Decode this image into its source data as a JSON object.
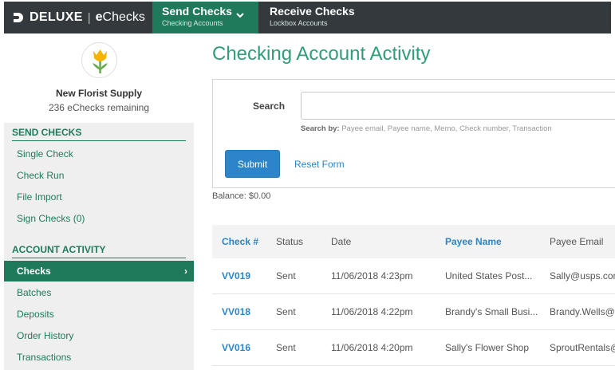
{
  "brand": {
    "name": "DELUXE",
    "separator": "|",
    "product_prefix": "e",
    "product_rest": "Checks"
  },
  "nav": {
    "send": {
      "title": "Send Checks",
      "subtitle": "Checking Accounts"
    },
    "receive": {
      "title": "Receive Checks",
      "subtitle": "Lockbox Accounts"
    }
  },
  "sidebar": {
    "company": "New Florist Supply",
    "remaining": "236 eChecks remaining",
    "send_heading": "SEND CHECKS",
    "send_items": [
      "Single Check",
      "Check Run",
      "File Import",
      "Sign Checks (0)"
    ],
    "activity_heading": "ACCOUNT ACTIVITY",
    "activity_items": [
      "Checks",
      "Batches",
      "Deposits",
      "Order History",
      "Transactions"
    ],
    "active_arrow": "›"
  },
  "main": {
    "title": "Checking Account Activity",
    "search_label": "Search",
    "search_value": "",
    "search_hint_label": "Search by:",
    "search_hint_text": "Payee email, Payee name, Memo, Check number, Transaction",
    "submit_label": "Submit",
    "reset_label": "Reset Form",
    "balance": "Balance: $0.00"
  },
  "table": {
    "headers": [
      "Check #",
      "Status",
      "Date",
      "Payee Name",
      "Payee Email"
    ],
    "rows": [
      [
        "VV019",
        "Sent",
        "11/06/2018 4:23pm",
        "United States Post...",
        "Sally@usps.com"
      ],
      [
        "VV018",
        "Sent",
        "11/06/2018 4:22pm",
        "Brandy's Small Busi...",
        "Brandy.Wells@"
      ],
      [
        "VV016",
        "Sent",
        "11/06/2018 4:20pm",
        "Sally's Flower Shop",
        "SproutRentals@"
      ]
    ]
  },
  "colors": {
    "brand_green": "#1f7a5c",
    "title_green": "#2f9c7a",
    "link_blue": "#2b85c8",
    "topbar": "#33393d"
  },
  "icons": {
    "brand": "deluxe-d-icon",
    "dropdown": "chevron-down-icon",
    "logo": "tulip-icon"
  }
}
